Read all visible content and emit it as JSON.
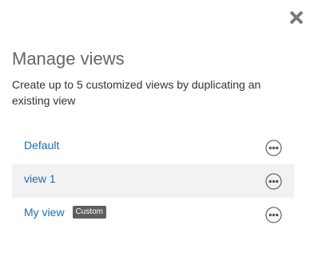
{
  "dialog": {
    "title": "Manage views",
    "description": "Create up to 5 customized views by duplicating an existing view",
    "close_icon": "close-icon"
  },
  "views": [
    {
      "name": "Default",
      "badge": "",
      "action_icon": "more-options-icon"
    },
    {
      "name": "view 1",
      "badge": "",
      "action_icon": "more-options-icon"
    },
    {
      "name": "My view",
      "badge": "Custom",
      "action_icon": "more-options-icon"
    }
  ],
  "colors": {
    "link": "#1a6fb0",
    "title": "#666666",
    "row_highlight": "#f2f2f2",
    "badge_bg": "#5f5f5f"
  }
}
